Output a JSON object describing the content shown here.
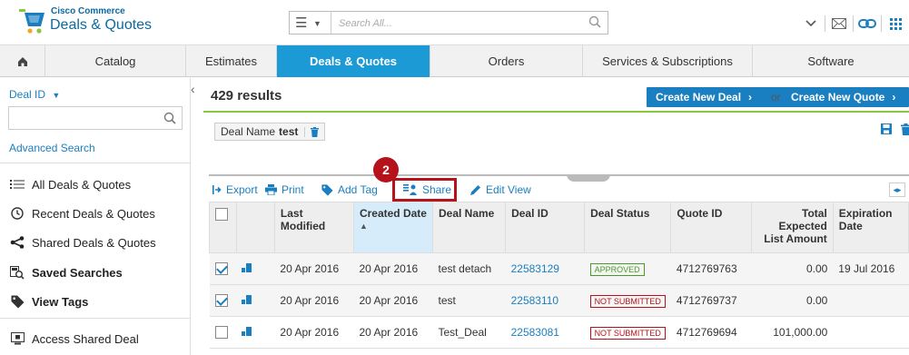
{
  "header": {
    "brand_small": "Cisco Commerce",
    "brand_title": "Deals & Quotes",
    "search_placeholder": "Search All...",
    "icons": [
      "menu-icon",
      "search-icon",
      "chevron-down-icon",
      "mail-icon",
      "link-icon",
      "apps-grid-icon"
    ]
  },
  "nav": {
    "home_icon": "home-icon",
    "items": [
      "Catalog",
      "Estimates",
      "Deals & Quotes",
      "Orders",
      "Services & Subscriptions",
      "Software"
    ],
    "active": "Deals & Quotes"
  },
  "sidebar": {
    "deal_id_label": "Deal ID",
    "advanced_search": "Advanced Search",
    "items": [
      "All Deals & Quotes",
      "Recent Deals & Quotes",
      "Shared Deals & Quotes",
      "Saved Searches",
      "View Tags",
      "Access Shared Deal"
    ]
  },
  "main": {
    "results": "429 results",
    "create_deal": "Create New Deal",
    "or_text": "or",
    "create_quote": "Create New Quote",
    "filter_tag_label": "Deal Name",
    "filter_tag_value": "test",
    "callout": "2"
  },
  "toolbar": {
    "export": "Export",
    "print": "Print",
    "add_tag": "Add Tag",
    "share": "Share",
    "edit_view": "Edit View"
  },
  "table": {
    "headers": {
      "last_modified": "Last Modified",
      "created_date": "Created Date",
      "deal_name": "Deal Name",
      "deal_id": "Deal ID",
      "deal_status": "Deal Status",
      "quote_id": "Quote ID",
      "total": "Total Expected List Amount",
      "expiration": "Expiration Date"
    },
    "rows": [
      {
        "checked": true,
        "last_modified": "20 Apr 2016",
        "created": "20 Apr 2016",
        "deal_name": "test detach",
        "deal_id": "22583129",
        "status": "APPROVED",
        "quote_id": "4712769763",
        "total": "0.00",
        "expiration": "19 Jul 2016"
      },
      {
        "checked": true,
        "last_modified": "20 Apr 2016",
        "created": "20 Apr 2016",
        "deal_name": "test",
        "deal_id": "22583110",
        "status": "NOT SUBMITTED",
        "quote_id": "4712769737",
        "total": "0.00",
        "expiration": ""
      },
      {
        "checked": false,
        "last_modified": "20 Apr 2016",
        "created": "20 Apr 2016",
        "deal_name": "Test_Deal",
        "deal_id": "22583081",
        "status": "NOT SUBMITTED",
        "quote_id": "4712769694",
        "total": "101,000.00",
        "expiration": ""
      }
    ]
  },
  "colors": {
    "accent_blue": "#1a7fc0",
    "nav_active": "#1b9ad6",
    "highlight_red": "#b5121b",
    "approved_green": "#4a9a2a"
  }
}
